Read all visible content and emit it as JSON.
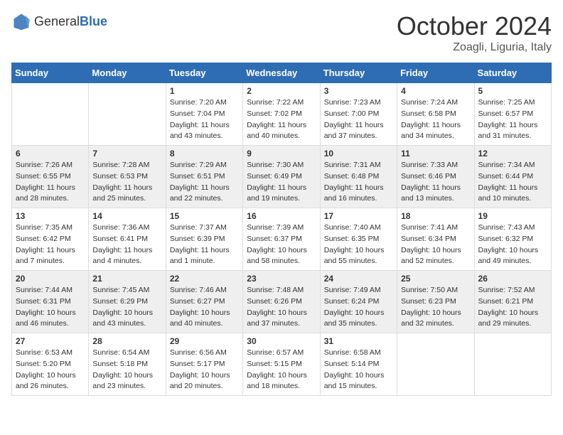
{
  "header": {
    "logo_general": "General",
    "logo_blue": "Blue",
    "month_title": "October 2024",
    "location": "Zoagli, Liguria, Italy"
  },
  "weekdays": [
    "Sunday",
    "Monday",
    "Tuesday",
    "Wednesday",
    "Thursday",
    "Friday",
    "Saturday"
  ],
  "weeks": [
    [
      {
        "day": "",
        "info": ""
      },
      {
        "day": "",
        "info": ""
      },
      {
        "day": "1",
        "info": "Sunrise: 7:20 AM\nSunset: 7:04 PM\nDaylight: 11 hours and 43 minutes."
      },
      {
        "day": "2",
        "info": "Sunrise: 7:22 AM\nSunset: 7:02 PM\nDaylight: 11 hours and 40 minutes."
      },
      {
        "day": "3",
        "info": "Sunrise: 7:23 AM\nSunset: 7:00 PM\nDaylight: 11 hours and 37 minutes."
      },
      {
        "day": "4",
        "info": "Sunrise: 7:24 AM\nSunset: 6:58 PM\nDaylight: 11 hours and 34 minutes."
      },
      {
        "day": "5",
        "info": "Sunrise: 7:25 AM\nSunset: 6:57 PM\nDaylight: 11 hours and 31 minutes."
      }
    ],
    [
      {
        "day": "6",
        "info": "Sunrise: 7:26 AM\nSunset: 6:55 PM\nDaylight: 11 hours and 28 minutes."
      },
      {
        "day": "7",
        "info": "Sunrise: 7:28 AM\nSunset: 6:53 PM\nDaylight: 11 hours and 25 minutes."
      },
      {
        "day": "8",
        "info": "Sunrise: 7:29 AM\nSunset: 6:51 PM\nDaylight: 11 hours and 22 minutes."
      },
      {
        "day": "9",
        "info": "Sunrise: 7:30 AM\nSunset: 6:49 PM\nDaylight: 11 hours and 19 minutes."
      },
      {
        "day": "10",
        "info": "Sunrise: 7:31 AM\nSunset: 6:48 PM\nDaylight: 11 hours and 16 minutes."
      },
      {
        "day": "11",
        "info": "Sunrise: 7:33 AM\nSunset: 6:46 PM\nDaylight: 11 hours and 13 minutes."
      },
      {
        "day": "12",
        "info": "Sunrise: 7:34 AM\nSunset: 6:44 PM\nDaylight: 11 hours and 10 minutes."
      }
    ],
    [
      {
        "day": "13",
        "info": "Sunrise: 7:35 AM\nSunset: 6:42 PM\nDaylight: 11 hours and 7 minutes."
      },
      {
        "day": "14",
        "info": "Sunrise: 7:36 AM\nSunset: 6:41 PM\nDaylight: 11 hours and 4 minutes."
      },
      {
        "day": "15",
        "info": "Sunrise: 7:37 AM\nSunset: 6:39 PM\nDaylight: 11 hours and 1 minute."
      },
      {
        "day": "16",
        "info": "Sunrise: 7:39 AM\nSunset: 6:37 PM\nDaylight: 10 hours and 58 minutes."
      },
      {
        "day": "17",
        "info": "Sunrise: 7:40 AM\nSunset: 6:35 PM\nDaylight: 10 hours and 55 minutes."
      },
      {
        "day": "18",
        "info": "Sunrise: 7:41 AM\nSunset: 6:34 PM\nDaylight: 10 hours and 52 minutes."
      },
      {
        "day": "19",
        "info": "Sunrise: 7:43 AM\nSunset: 6:32 PM\nDaylight: 10 hours and 49 minutes."
      }
    ],
    [
      {
        "day": "20",
        "info": "Sunrise: 7:44 AM\nSunset: 6:31 PM\nDaylight: 10 hours and 46 minutes."
      },
      {
        "day": "21",
        "info": "Sunrise: 7:45 AM\nSunset: 6:29 PM\nDaylight: 10 hours and 43 minutes."
      },
      {
        "day": "22",
        "info": "Sunrise: 7:46 AM\nSunset: 6:27 PM\nDaylight: 10 hours and 40 minutes."
      },
      {
        "day": "23",
        "info": "Sunrise: 7:48 AM\nSunset: 6:26 PM\nDaylight: 10 hours and 37 minutes."
      },
      {
        "day": "24",
        "info": "Sunrise: 7:49 AM\nSunset: 6:24 PM\nDaylight: 10 hours and 35 minutes."
      },
      {
        "day": "25",
        "info": "Sunrise: 7:50 AM\nSunset: 6:23 PM\nDaylight: 10 hours and 32 minutes."
      },
      {
        "day": "26",
        "info": "Sunrise: 7:52 AM\nSunset: 6:21 PM\nDaylight: 10 hours and 29 minutes."
      }
    ],
    [
      {
        "day": "27",
        "info": "Sunrise: 6:53 AM\nSunset: 5:20 PM\nDaylight: 10 hours and 26 minutes."
      },
      {
        "day": "28",
        "info": "Sunrise: 6:54 AM\nSunset: 5:18 PM\nDaylight: 10 hours and 23 minutes."
      },
      {
        "day": "29",
        "info": "Sunrise: 6:56 AM\nSunset: 5:17 PM\nDaylight: 10 hours and 20 minutes."
      },
      {
        "day": "30",
        "info": "Sunrise: 6:57 AM\nSunset: 5:15 PM\nDaylight: 10 hours and 18 minutes."
      },
      {
        "day": "31",
        "info": "Sunrise: 6:58 AM\nSunset: 5:14 PM\nDaylight: 10 hours and 15 minutes."
      },
      {
        "day": "",
        "info": ""
      },
      {
        "day": "",
        "info": ""
      }
    ]
  ]
}
